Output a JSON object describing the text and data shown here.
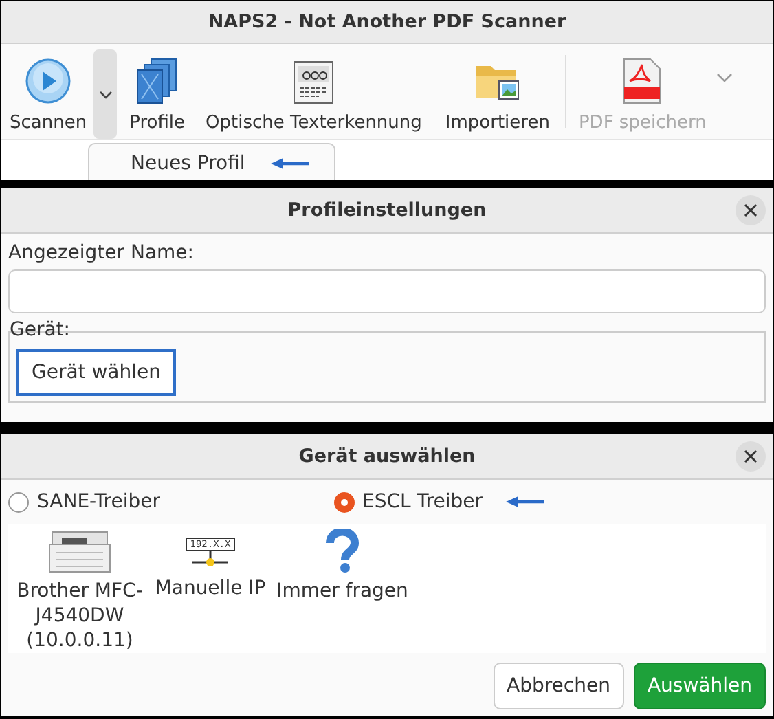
{
  "main_window": {
    "title": "NAPS2 - Not Another PDF Scanner",
    "toolbar": [
      {
        "kind": "scan",
        "label": "Scannen",
        "disabled": false
      },
      {
        "kind": "dropdown",
        "expanded": true
      },
      {
        "kind": "profiles",
        "label": "Profile",
        "disabled": false
      },
      {
        "kind": "ocr",
        "label": "Optische Texterkennung",
        "disabled": false
      },
      {
        "kind": "import",
        "label": "Importieren",
        "disabled": false
      },
      {
        "kind": "separator"
      },
      {
        "kind": "pdf",
        "label": "PDF speichern",
        "disabled": true
      },
      {
        "kind": "overflow"
      }
    ],
    "dropdown_menu": [
      {
        "label": "Neues Profil",
        "marked": true
      }
    ]
  },
  "profile_dialog": {
    "title": "Profileinstellungen",
    "name_label": "Angezeigter Name:",
    "device_label": "Gerät:",
    "choose_device_button": {
      "label": "Gerät wählen",
      "focused": true
    }
  },
  "device_dialog": {
    "title": "Gerät auswählen",
    "drivers": [
      {
        "label": "SANE-Treiber",
        "selected": false,
        "marked": false
      },
      {
        "label": "ESCL Treiber",
        "selected": true,
        "marked": true
      }
    ],
    "devices": [
      {
        "kind": "printer",
        "name": "Brother MFC-J4540DW (10.0.0.11)"
      },
      {
        "kind": "ip",
        "name": "Manuelle IP",
        "icon_text": "192.X.X"
      },
      {
        "kind": "ask",
        "name": "Immer fragen"
      }
    ],
    "buttons": [
      {
        "label": "Abbrechen",
        "kind": "secondary"
      },
      {
        "label": "Auswählen",
        "kind": "primary"
      }
    ]
  }
}
